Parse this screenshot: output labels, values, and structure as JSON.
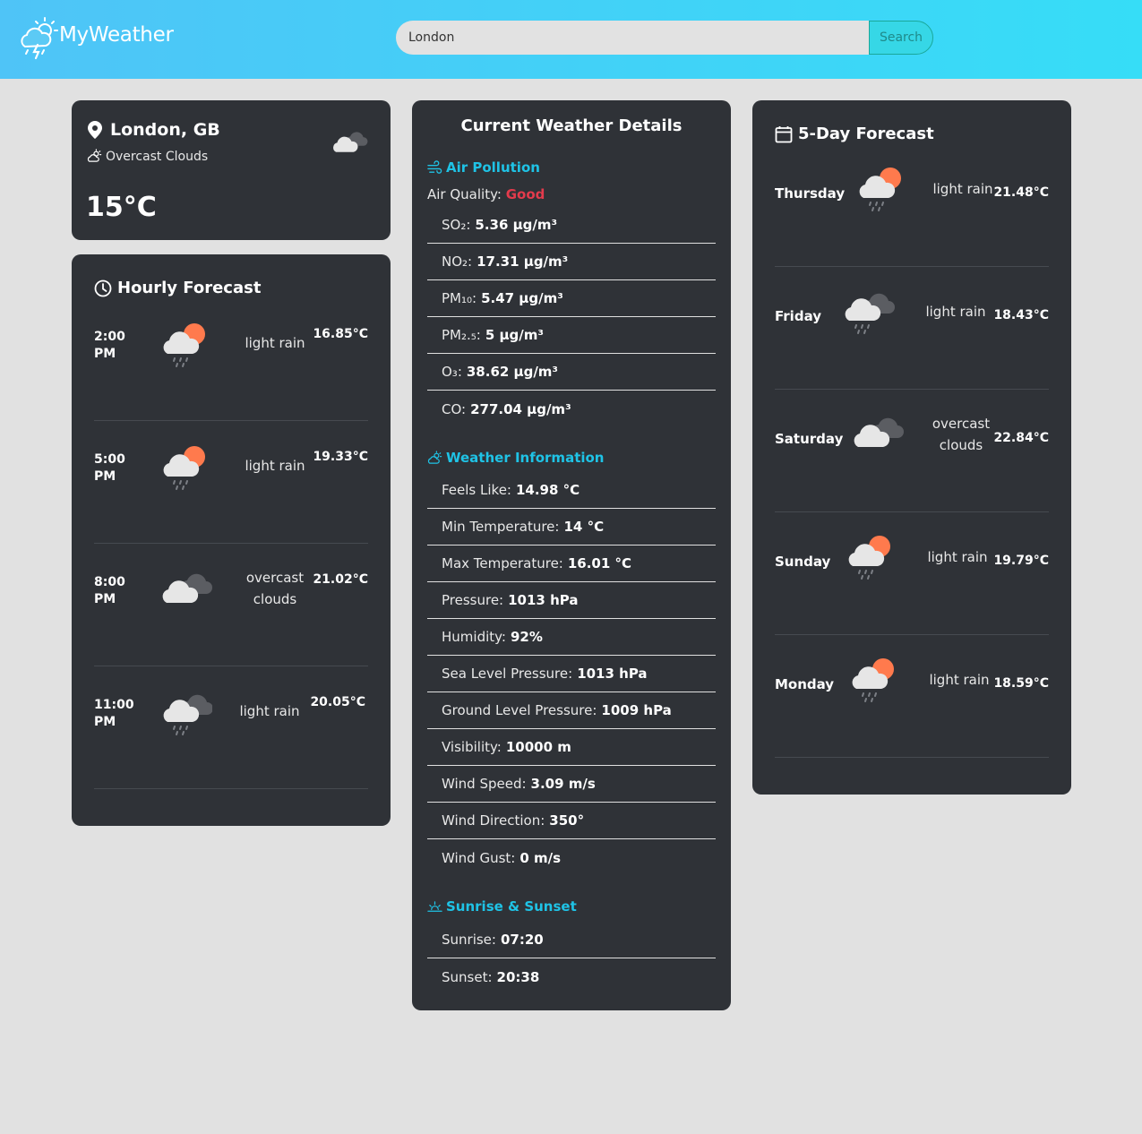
{
  "header": {
    "logo_text": "MyWeather",
    "search_value": "London",
    "search_button": "Search"
  },
  "current": {
    "location": "London, GB",
    "description": "Overcast Clouds",
    "temperature": "15°C",
    "icon": "overcast-cloud-icon"
  },
  "hourly": {
    "title": "Hourly Forecast",
    "items": [
      {
        "time": "2:00 PM",
        "icon": "sun-cloud-rain-icon",
        "desc": "light rain",
        "temp": "16.85°C"
      },
      {
        "time": "5:00 PM",
        "icon": "sun-cloud-rain-icon",
        "desc": "light rain",
        "temp": "19.33°C"
      },
      {
        "time": "8:00 PM",
        "icon": "overcast-cloud-icon",
        "desc": "overcast clouds",
        "temp": "21.02°C"
      },
      {
        "time": "11:00 PM",
        "icon": "cloud-rain-icon",
        "desc": "light rain",
        "temp": "20.05°C"
      }
    ]
  },
  "details": {
    "title": "Current Weather Details",
    "air_pollution": {
      "title": "Air Pollution",
      "quality_label": "Air Quality:",
      "quality_value": "Good",
      "quality_color": "#e33b4c",
      "items": [
        {
          "label": "SO₂:",
          "value": "5.36 µg/m³"
        },
        {
          "label": "NO₂:",
          "value": "17.31 µg/m³"
        },
        {
          "label": "PM₁₀:",
          "value": "5.47 µg/m³"
        },
        {
          "label": "PM₂.₅:",
          "value": "5 µg/m³"
        },
        {
          "label": "O₃:",
          "value": "38.62 µg/m³"
        },
        {
          "label": "CO:",
          "value": "277.04 µg/m³"
        }
      ]
    },
    "weather_info": {
      "title": "Weather Information",
      "items": [
        {
          "label": "Feels Like:",
          "value": "14.98 °C"
        },
        {
          "label": "Min Temperature:",
          "value": "14 °C"
        },
        {
          "label": "Max Temperature:",
          "value": "16.01 °C"
        },
        {
          "label": "Pressure:",
          "value": "1013 hPa"
        },
        {
          "label": "Humidity:",
          "value": "92%"
        },
        {
          "label": "Sea Level Pressure:",
          "value": "1013 hPa"
        },
        {
          "label": "Ground Level Pressure:",
          "value": "1009 hPa"
        },
        {
          "label": "Visibility:",
          "value": "10000 m"
        },
        {
          "label": "Wind Speed:",
          "value": "3.09 m/s"
        },
        {
          "label": "Wind Direction:",
          "value": "350°"
        },
        {
          "label": "Wind Gust:",
          "value": "0 m/s"
        }
      ]
    },
    "sun": {
      "title": "Sunrise & Sunset",
      "items": [
        {
          "label": "Sunrise:",
          "value": "07:20"
        },
        {
          "label": "Sunset:",
          "value": "20:38"
        }
      ]
    }
  },
  "forecast": {
    "title": "5-Day Forecast",
    "items": [
      {
        "day": "Thursday",
        "icon": "sun-cloud-rain-icon",
        "desc": "light rain",
        "temp": "21.48°C"
      },
      {
        "day": "Friday",
        "icon": "cloud-rain-icon",
        "desc": "light rain",
        "temp": "18.43°C"
      },
      {
        "day": "Saturday",
        "icon": "overcast-cloud-icon",
        "desc": "overcast clouds",
        "temp": "22.84°C"
      },
      {
        "day": "Sunday",
        "icon": "sun-cloud-rain-icon",
        "desc": "light rain",
        "temp": "19.79°C"
      },
      {
        "day": "Monday",
        "icon": "sun-cloud-rain-icon",
        "desc": "light rain",
        "temp": "18.59°C"
      }
    ]
  },
  "colors": {
    "header_start": "#4fc4f7",
    "header_end": "#36ddf7",
    "card": "#2f3237",
    "accent": "#1fc3e6",
    "sun": "#ff7a4d"
  }
}
